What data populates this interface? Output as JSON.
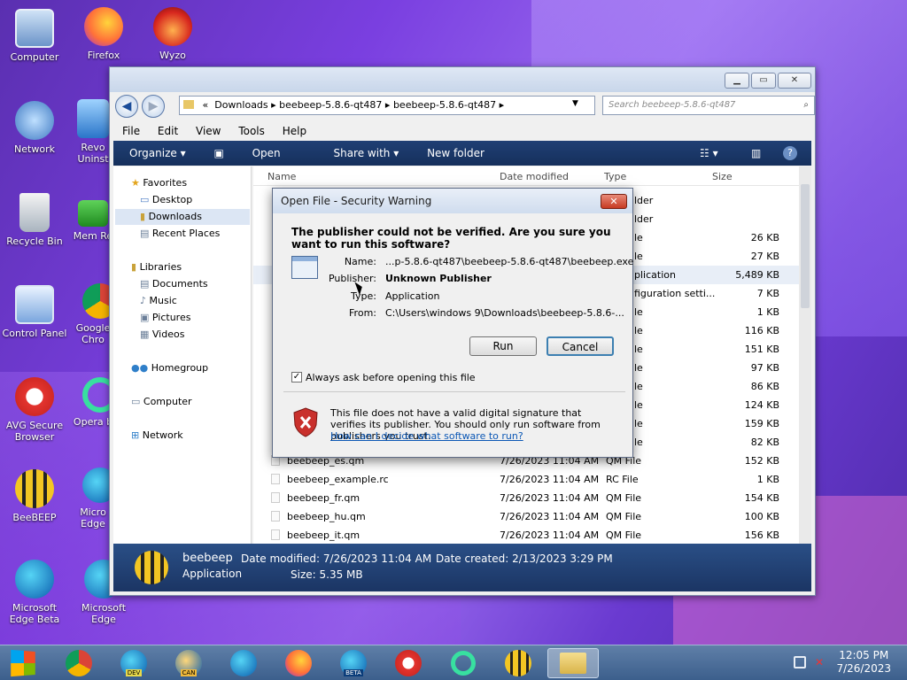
{
  "desktop": {
    "icons": [
      {
        "label": "Computer"
      },
      {
        "label": "Firefox"
      },
      {
        "label": "Wyzo"
      },
      {
        "label": "Network"
      },
      {
        "label": "Revo Uninst"
      },
      {
        "label": "Recycle Bin"
      },
      {
        "label": "Mem Re"
      },
      {
        "label": "Control Panel"
      },
      {
        "label": "Google Chro"
      },
      {
        "label": "AVG Secure Browser"
      },
      {
        "label": "Opera b"
      },
      {
        "label": "BeeBEEP"
      },
      {
        "label": "Micro Edge"
      },
      {
        "label": "Microsoft Edge Beta"
      },
      {
        "label": "Microsoft Edge"
      }
    ]
  },
  "explorer": {
    "back_glyph": "◀",
    "forward_glyph": "▶",
    "address_prefix": "«",
    "address": [
      "Downloads",
      "beebeep-5.8.6-qt487",
      "beebeep-5.8.6-qt487"
    ],
    "search_placeholder": "Search beebeep-5.8.6-qt487",
    "menu": [
      "File",
      "Edit",
      "View",
      "Tools",
      "Help"
    ],
    "commands": [
      "Organize ▾",
      "Open",
      "Share with ▾",
      "New folder"
    ],
    "nav": {
      "favorites": "Favorites",
      "desktop": "Desktop",
      "downloads": "Downloads",
      "recent": "Recent Places",
      "libraries": "Libraries",
      "documents": "Documents",
      "music": "Music",
      "pictures": "Pictures",
      "videos": "Videos",
      "homegroup": "Homegroup",
      "computer": "Computer",
      "network": "Network"
    },
    "columns": {
      "name": "Name",
      "date": "Date modified",
      "type": "Type",
      "size": "Size"
    },
    "hidden_rows": [
      {
        "type": "lder",
        "size": ""
      },
      {
        "type": "lder",
        "size": ""
      },
      {
        "type": "le",
        "size": "26 KB"
      },
      {
        "type": "le",
        "size": "27 KB"
      },
      {
        "type": "plication",
        "size": "5,489 KB"
      },
      {
        "type": "figuration setti...",
        "size": "7 KB"
      },
      {
        "type": "le",
        "size": "1 KB"
      },
      {
        "type": "le",
        "size": "116 KB"
      },
      {
        "type": "le",
        "size": "151 KB"
      },
      {
        "type": "le",
        "size": "97 KB"
      },
      {
        "type": "le",
        "size": "86 KB"
      },
      {
        "type": "le",
        "size": "124 KB"
      },
      {
        "type": "le",
        "size": "159 KB"
      },
      {
        "type": "le",
        "size": "82 KB"
      }
    ],
    "rows": [
      {
        "name": "beebeep_es.qm",
        "date": "7/26/2023 11:04 AM",
        "type": "QM File",
        "size": "152 KB"
      },
      {
        "name": "beebeep_example.rc",
        "date": "7/26/2023 11:04 AM",
        "type": "RC File",
        "size": "1 KB"
      },
      {
        "name": "beebeep_fr.qm",
        "date": "7/26/2023 11:04 AM",
        "type": "QM File",
        "size": "154 KB"
      },
      {
        "name": "beebeep_hu.qm",
        "date": "7/26/2023 11:04 AM",
        "type": "QM File",
        "size": "100 KB"
      },
      {
        "name": "beebeep_it.qm",
        "date": "7/26/2023 11:04 AM",
        "type": "QM File",
        "size": "156 KB"
      }
    ],
    "details": {
      "name": "beebeep",
      "kind": "Application",
      "modified": "Date modified: 7/26/2023 11:04 AM",
      "created": "Date created: 2/13/2023 3:29 PM",
      "size": "Size: 5.35 MB"
    }
  },
  "dialog": {
    "title": "Open File - Security Warning",
    "question": "The publisher could not be verified.  Are you sure you want to run this software?",
    "name_label": "Name:",
    "name_value": "...p-5.8.6-qt487\\beebeep-5.8.6-qt487\\beebeep.exe",
    "publisher_label": "Publisher:",
    "publisher_value": "Unknown Publisher",
    "type_label": "Type:",
    "type_value": "Application",
    "from_label": "From:",
    "from_value": "C:\\Users\\windows 9\\Downloads\\beebeep-5.8.6-...",
    "run": "Run",
    "cancel": "Cancel",
    "always_ask": "Always ask before opening this file",
    "warning": "This file does not have a valid digital signature that verifies its publisher.  You should only run software from publishers you trust.",
    "help_link": "How can I decide what software to run?"
  },
  "taskbar": {
    "time": "12:05 PM",
    "date": "7/26/2023",
    "badges": [
      "DEV",
      "CAN",
      "BETA"
    ]
  },
  "colors": {
    "accent": "#1f3f74",
    "danger": "#c73a22"
  }
}
